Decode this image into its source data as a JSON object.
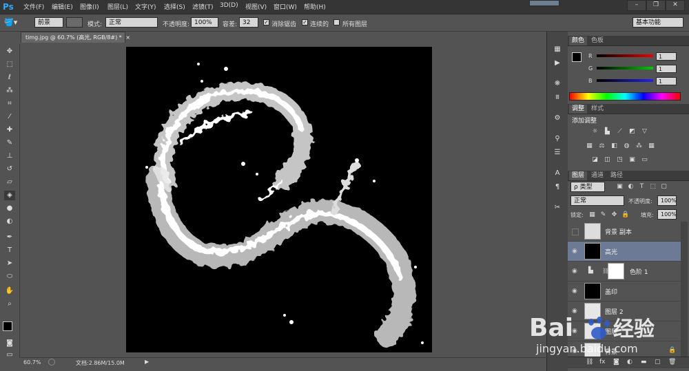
{
  "app": {
    "logo": "Ps",
    "menu": [
      "文件(F)",
      "编辑(E)",
      "图像(I)",
      "图层(L)",
      "文字(Y)",
      "选择(S)",
      "滤镜(T)",
      "3D(D)",
      "视图(V)",
      "窗口(W)",
      "帮助(H)"
    ],
    "window_buttons": [
      "–",
      "❐",
      "✕"
    ]
  },
  "options_bar": {
    "fill_source": "前景",
    "mode_label": "模式:",
    "mode_value": "正常",
    "opacity_label": "不透明度:",
    "opacity_value": "100%",
    "tolerance_label": "容差:",
    "tolerance_value": "32",
    "antialias_label": "消除锯齿",
    "contiguous_label": "连续的",
    "all_layers_label": "所有图层",
    "workspace": "基本功能"
  },
  "document": {
    "tab_title": "timg.jpg @ 60.7% (高光, RGB/8#) *",
    "close": "×",
    "zoom": "60.7%",
    "doc_info": "文档:2.86M/15.0M"
  },
  "color_panel": {
    "tabs": [
      "颜色",
      "色板"
    ],
    "channels": [
      {
        "label": "R",
        "value": "1"
      },
      {
        "label": "G",
        "value": "1"
      },
      {
        "label": "B",
        "value": "1"
      }
    ]
  },
  "adjust_panel": {
    "tabs": [
      "调整",
      "样式"
    ],
    "heading": "添加调整"
  },
  "layers_panel": {
    "tabs": [
      "图层",
      "通道",
      "路径"
    ],
    "filter_label": "ρ 类型",
    "blend_mode": "正常",
    "opacity_label": "不透明度:",
    "opacity_value": "100%",
    "lock_label": "锁定:",
    "fill_label": "填充:",
    "fill_value": "100%",
    "layers": [
      {
        "name": "背景 副本",
        "visible": false,
        "selected": false
      },
      {
        "name": "高光",
        "visible": true,
        "selected": true
      },
      {
        "name": "色阶 1",
        "visible": true,
        "selected": false
      },
      {
        "name": "盖印",
        "visible": true,
        "selected": false
      },
      {
        "name": "图层 2",
        "visible": true,
        "selected": false
      },
      {
        "name": "图层",
        "visible": true,
        "selected": false
      },
      {
        "name": "背景",
        "visible": true,
        "selected": false
      }
    ]
  },
  "watermark": {
    "brand": "Bai",
    "brand2": "经验",
    "url": "jingyan.baidu.com"
  },
  "colors": {
    "accent": "#31a8ff",
    "selected_layer": "#6c7a95"
  }
}
